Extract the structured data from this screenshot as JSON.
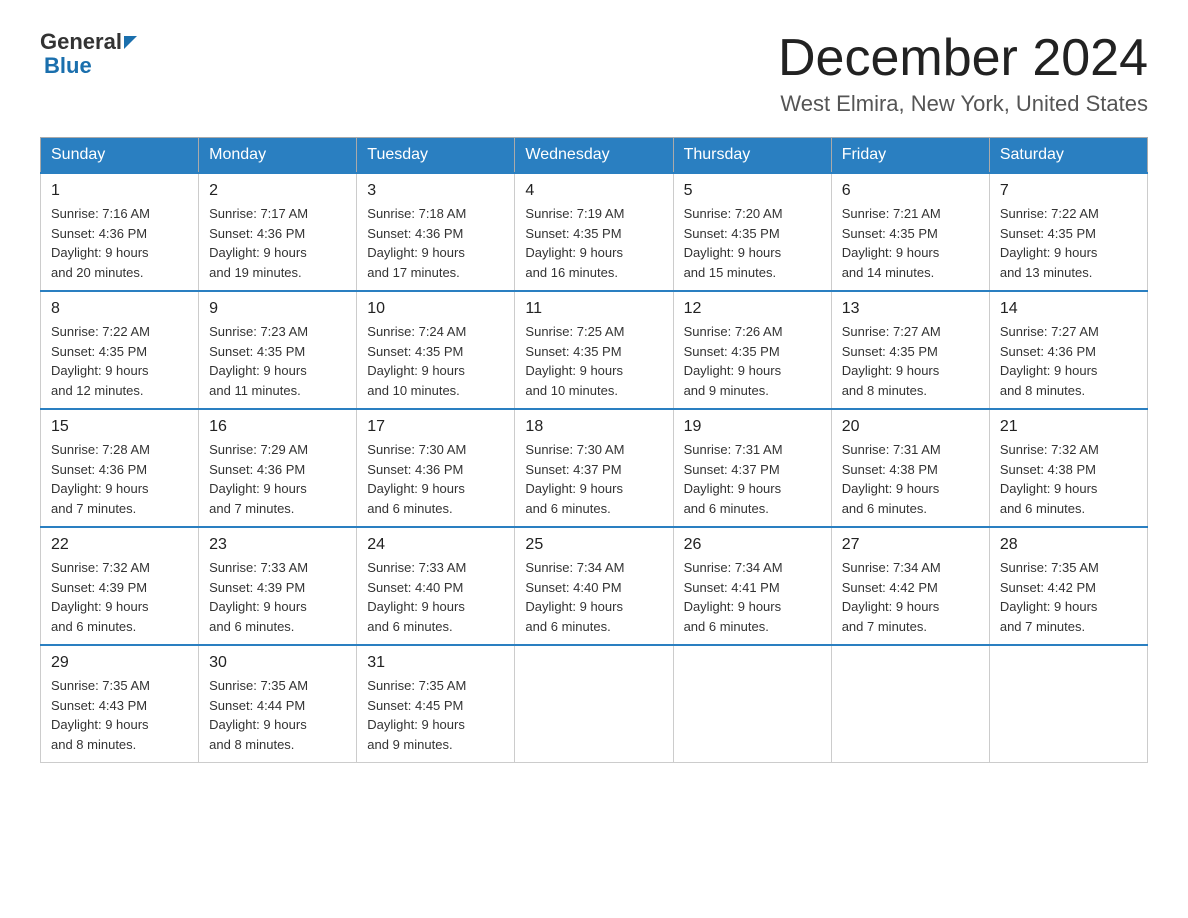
{
  "header": {
    "logo_general": "General",
    "logo_blue": "Blue",
    "title": "December 2024",
    "subtitle": "West Elmira, New York, United States"
  },
  "days_of_week": [
    "Sunday",
    "Monday",
    "Tuesday",
    "Wednesday",
    "Thursday",
    "Friday",
    "Saturday"
  ],
  "weeks": [
    [
      {
        "day": "1",
        "sunrise": "7:16 AM",
        "sunset": "4:36 PM",
        "daylight": "9 hours and 20 minutes."
      },
      {
        "day": "2",
        "sunrise": "7:17 AM",
        "sunset": "4:36 PM",
        "daylight": "9 hours and 19 minutes."
      },
      {
        "day": "3",
        "sunrise": "7:18 AM",
        "sunset": "4:36 PM",
        "daylight": "9 hours and 17 minutes."
      },
      {
        "day": "4",
        "sunrise": "7:19 AM",
        "sunset": "4:35 PM",
        "daylight": "9 hours and 16 minutes."
      },
      {
        "day": "5",
        "sunrise": "7:20 AM",
        "sunset": "4:35 PM",
        "daylight": "9 hours and 15 minutes."
      },
      {
        "day": "6",
        "sunrise": "7:21 AM",
        "sunset": "4:35 PM",
        "daylight": "9 hours and 14 minutes."
      },
      {
        "day": "7",
        "sunrise": "7:22 AM",
        "sunset": "4:35 PM",
        "daylight": "9 hours and 13 minutes."
      }
    ],
    [
      {
        "day": "8",
        "sunrise": "7:22 AM",
        "sunset": "4:35 PM",
        "daylight": "9 hours and 12 minutes."
      },
      {
        "day": "9",
        "sunrise": "7:23 AM",
        "sunset": "4:35 PM",
        "daylight": "9 hours and 11 minutes."
      },
      {
        "day": "10",
        "sunrise": "7:24 AM",
        "sunset": "4:35 PM",
        "daylight": "9 hours and 10 minutes."
      },
      {
        "day": "11",
        "sunrise": "7:25 AM",
        "sunset": "4:35 PM",
        "daylight": "9 hours and 10 minutes."
      },
      {
        "day": "12",
        "sunrise": "7:26 AM",
        "sunset": "4:35 PM",
        "daylight": "9 hours and 9 minutes."
      },
      {
        "day": "13",
        "sunrise": "7:27 AM",
        "sunset": "4:35 PM",
        "daylight": "9 hours and 8 minutes."
      },
      {
        "day": "14",
        "sunrise": "7:27 AM",
        "sunset": "4:36 PM",
        "daylight": "9 hours and 8 minutes."
      }
    ],
    [
      {
        "day": "15",
        "sunrise": "7:28 AM",
        "sunset": "4:36 PM",
        "daylight": "9 hours and 7 minutes."
      },
      {
        "day": "16",
        "sunrise": "7:29 AM",
        "sunset": "4:36 PM",
        "daylight": "9 hours and 7 minutes."
      },
      {
        "day": "17",
        "sunrise": "7:30 AM",
        "sunset": "4:36 PM",
        "daylight": "9 hours and 6 minutes."
      },
      {
        "day": "18",
        "sunrise": "7:30 AM",
        "sunset": "4:37 PM",
        "daylight": "9 hours and 6 minutes."
      },
      {
        "day": "19",
        "sunrise": "7:31 AM",
        "sunset": "4:37 PM",
        "daylight": "9 hours and 6 minutes."
      },
      {
        "day": "20",
        "sunrise": "7:31 AM",
        "sunset": "4:38 PM",
        "daylight": "9 hours and 6 minutes."
      },
      {
        "day": "21",
        "sunrise": "7:32 AM",
        "sunset": "4:38 PM",
        "daylight": "9 hours and 6 minutes."
      }
    ],
    [
      {
        "day": "22",
        "sunrise": "7:32 AM",
        "sunset": "4:39 PM",
        "daylight": "9 hours and 6 minutes."
      },
      {
        "day": "23",
        "sunrise": "7:33 AM",
        "sunset": "4:39 PM",
        "daylight": "9 hours and 6 minutes."
      },
      {
        "day": "24",
        "sunrise": "7:33 AM",
        "sunset": "4:40 PM",
        "daylight": "9 hours and 6 minutes."
      },
      {
        "day": "25",
        "sunrise": "7:34 AM",
        "sunset": "4:40 PM",
        "daylight": "9 hours and 6 minutes."
      },
      {
        "day": "26",
        "sunrise": "7:34 AM",
        "sunset": "4:41 PM",
        "daylight": "9 hours and 6 minutes."
      },
      {
        "day": "27",
        "sunrise": "7:34 AM",
        "sunset": "4:42 PM",
        "daylight": "9 hours and 7 minutes."
      },
      {
        "day": "28",
        "sunrise": "7:35 AM",
        "sunset": "4:42 PM",
        "daylight": "9 hours and 7 minutes."
      }
    ],
    [
      {
        "day": "29",
        "sunrise": "7:35 AM",
        "sunset": "4:43 PM",
        "daylight": "9 hours and 8 minutes."
      },
      {
        "day": "30",
        "sunrise": "7:35 AM",
        "sunset": "4:44 PM",
        "daylight": "9 hours and 8 minutes."
      },
      {
        "day": "31",
        "sunrise": "7:35 AM",
        "sunset": "4:45 PM",
        "daylight": "9 hours and 9 minutes."
      },
      null,
      null,
      null,
      null
    ]
  ],
  "labels": {
    "sunrise": "Sunrise:",
    "sunset": "Sunset:",
    "daylight": "Daylight:"
  }
}
